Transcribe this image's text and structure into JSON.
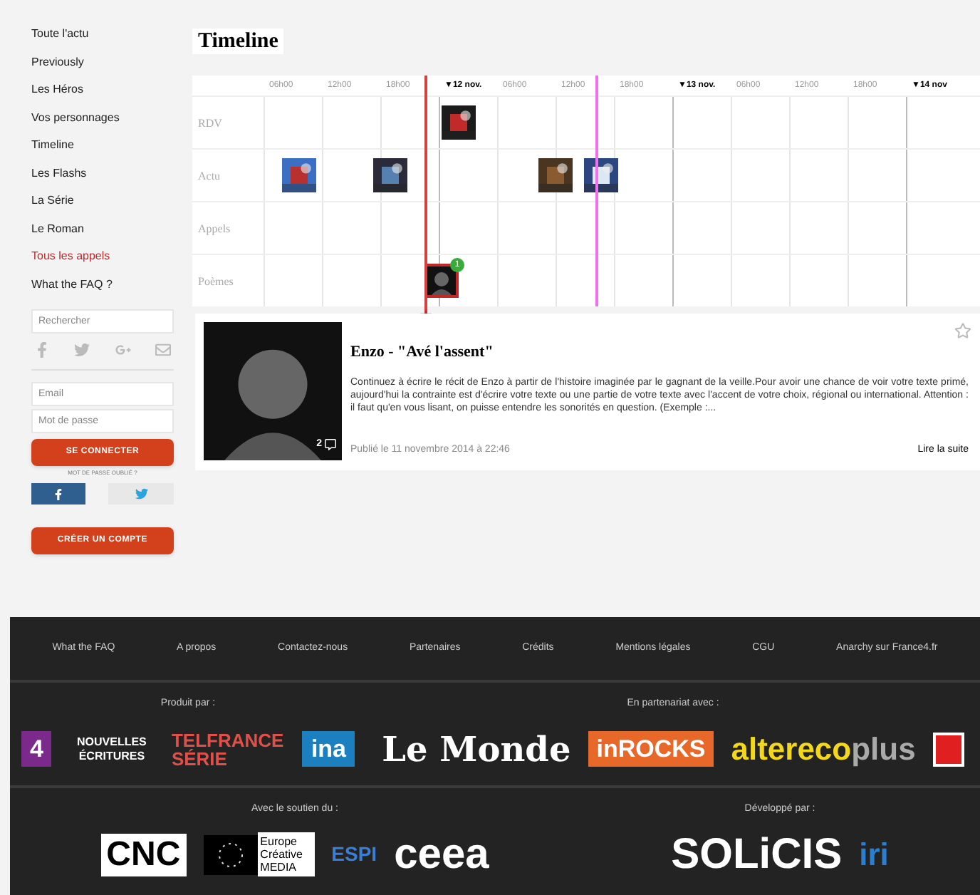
{
  "sidebar": {
    "items": [
      {
        "label": "Toute l'actu",
        "selected": false
      },
      {
        "label": "Previously",
        "selected": false
      },
      {
        "label": "Les Héros",
        "selected": false
      },
      {
        "label": "Vos personnages",
        "selected": false
      },
      {
        "label": "Timeline",
        "selected": false
      },
      {
        "label": "Les Flashs",
        "selected": false
      },
      {
        "label": "La Série",
        "selected": false
      },
      {
        "label": "Le Roman",
        "selected": false
      },
      {
        "label": "Tous les appels",
        "selected": true
      },
      {
        "label": "What the FAQ ?",
        "selected": false
      }
    ],
    "search": {
      "placeholder": "Rechercher"
    },
    "login": {
      "email_placeholder": "Email",
      "password_placeholder": "Mot de passe",
      "submit": "SE CONNECTER",
      "forgot": "MOT DE PASSE OUBLIÉ ?",
      "signup": "CRÉER UN COMPTE"
    }
  },
  "timeline": {
    "title": "Timeline",
    "columns": [
      {
        "label": "06h00",
        "kind": "time"
      },
      {
        "label": "12h00",
        "kind": "time"
      },
      {
        "label": "18h00",
        "kind": "time"
      },
      {
        "label": "▼12 nov.",
        "kind": "day"
      },
      {
        "label": "06h00",
        "kind": "time"
      },
      {
        "label": "12h00",
        "kind": "time"
      },
      {
        "label": "18h00",
        "kind": "time"
      },
      {
        "label": "▼13 nov.",
        "kind": "day"
      },
      {
        "label": "06h00",
        "kind": "time"
      },
      {
        "label": "12h00",
        "kind": "time"
      },
      {
        "label": "18h00",
        "kind": "time"
      },
      {
        "label": "▼14 nov",
        "kind": "day"
      }
    ],
    "rows": [
      {
        "label": "RDV",
        "events": [
          {
            "selected": false
          }
        ]
      },
      {
        "label": "Actu",
        "events": [
          {
            "selected": false
          },
          {
            "selected": false
          },
          {
            "selected": false
          },
          {
            "selected": false
          }
        ]
      },
      {
        "label": "Appels",
        "events": []
      },
      {
        "label": "Poèmes",
        "events": [
          {
            "selected": true,
            "badge": "1"
          }
        ]
      }
    ]
  },
  "article": {
    "title": "Enzo - \"Avé l'assent\"",
    "comments": "2",
    "body": "Continuez à écrire le récit de Enzo à partir de l'histoire imaginée par le gagnant de la veille.Pour avoir une chance de voir votre texte primé, aujourd'hui la contrainte est d'écrire votre texte ou une partie de votre texte avec l'accent de votre choix, régional ou international. Attention : il faut qu'en vous lisant, on puisse entendre les sonorités en question. (Exemple :...",
    "date": "Publié le 11 novembre 2014 à 22:46",
    "more": "Lire la suite",
    "starred": false
  },
  "footer": {
    "links": [
      "What the FAQ",
      "A propos",
      "Contactez-nous",
      "Partenaires",
      "Crédits",
      "Mentions légales",
      "CGU",
      "Anarchy sur France4.fr"
    ],
    "sections": [
      {
        "title": "Produit par :",
        "logos": [
          {
            "kind": "square",
            "text": "4",
            "color": "#7b2a8c"
          },
          {
            "kind": "stack",
            "text": "NOUVELLES ÉCRITURES"
          },
          {
            "kind": "telfrance",
            "text": "TELFRANCE SÉRIE"
          },
          {
            "kind": "square",
            "text": "ina",
            "color": "#1b7fc0"
          }
        ]
      },
      {
        "title": "En partenariat avec :",
        "logos": [
          {
            "kind": "gothic",
            "text": "Le Monde"
          },
          {
            "kind": "square",
            "text": "inROCKS",
            "color": "#e8682a"
          },
          {
            "kind": "altereco",
            "text": "altereco",
            "extra": "plus"
          },
          {
            "kind": "mark"
          }
        ]
      },
      {
        "title": "Avec le soutien du :",
        "logos": [
          {
            "kind": "cnc",
            "text": "CNC"
          },
          {
            "kind": "eu",
            "text": "Europe Créative MEDIA"
          },
          {
            "kind": "espi",
            "text": "ESPI"
          },
          {
            "kind": "big",
            "text": "ceea"
          }
        ]
      },
      {
        "title": "Développé par :",
        "logos": [
          {
            "kind": "big",
            "text": "SOLiCIS"
          },
          {
            "kind": "iri",
            "text": "iri"
          }
        ]
      }
    ]
  }
}
